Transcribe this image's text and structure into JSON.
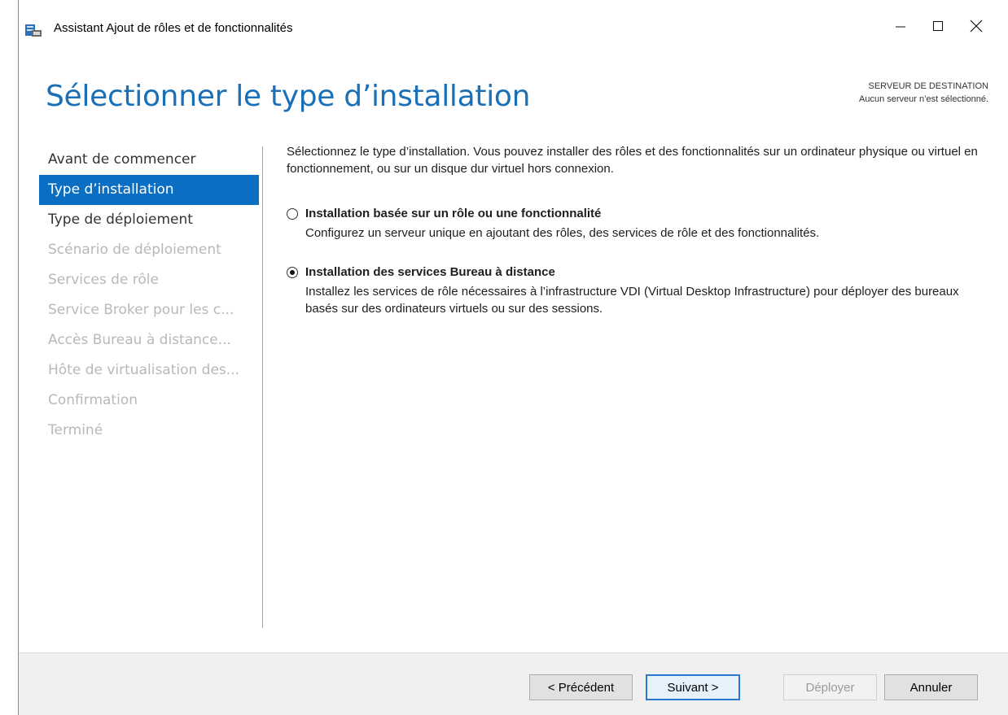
{
  "window": {
    "title": "Assistant Ajout de rôles et de fonctionnalités",
    "icon": "server-manager-icon",
    "controls": [
      "minimize-icon",
      "maximize-icon",
      "close-icon"
    ]
  },
  "header": {
    "page_title": "Sélectionner le type d’installation",
    "destination_label": "SERVEUR DE DESTINATION",
    "destination_value": "Aucun serveur n’est sélectionné."
  },
  "nav": {
    "items": [
      {
        "label": "Avant de commencer",
        "state": "enabled"
      },
      {
        "label": "Type d’installation",
        "state": "active"
      },
      {
        "label": "Type de déploiement",
        "state": "enabled"
      },
      {
        "label": "Scénario de déploiement",
        "state": "disabled"
      },
      {
        "label": "Services de rôle",
        "state": "disabled"
      },
      {
        "label": "Service Broker pour les c...",
        "state": "disabled"
      },
      {
        "label": "Accès Bureau à distance...",
        "state": "disabled"
      },
      {
        "label": "Hôte de virtualisation des...",
        "state": "disabled"
      },
      {
        "label": "Confirmation",
        "state": "disabled"
      },
      {
        "label": "Terminé",
        "state": "disabled"
      }
    ]
  },
  "content": {
    "intro": "Sélectionnez le type d’installation. Vous pouvez installer des rôles et des fonctionnalités sur un ordinateur physique ou virtuel en fonctionnement, ou sur un disque dur virtuel hors connexion.",
    "options": [
      {
        "title": "Installation basée sur un rôle ou une fonctionnalité",
        "description": "Configurez un serveur unique en ajoutant des rôles, des services de rôle et des fonctionnalités.",
        "selected": false
      },
      {
        "title": "Installation des services Bureau à distance",
        "description": "Installez les services de rôle nécessaires à l’infrastructure VDI (Virtual Desktop Infrastructure) pour déployer des bureaux basés sur des ordinateurs virtuels ou sur des sessions.",
        "selected": true
      }
    ]
  },
  "footer": {
    "previous": "< Précédent",
    "next": "Suivant >",
    "deploy": "Déployer",
    "cancel": "Annuler"
  },
  "colors": {
    "accent": "#0a6fc2",
    "title_blue": "#1a70b8",
    "disabled_text": "#b8b8b8",
    "footer_bg": "#f0f0f0"
  }
}
